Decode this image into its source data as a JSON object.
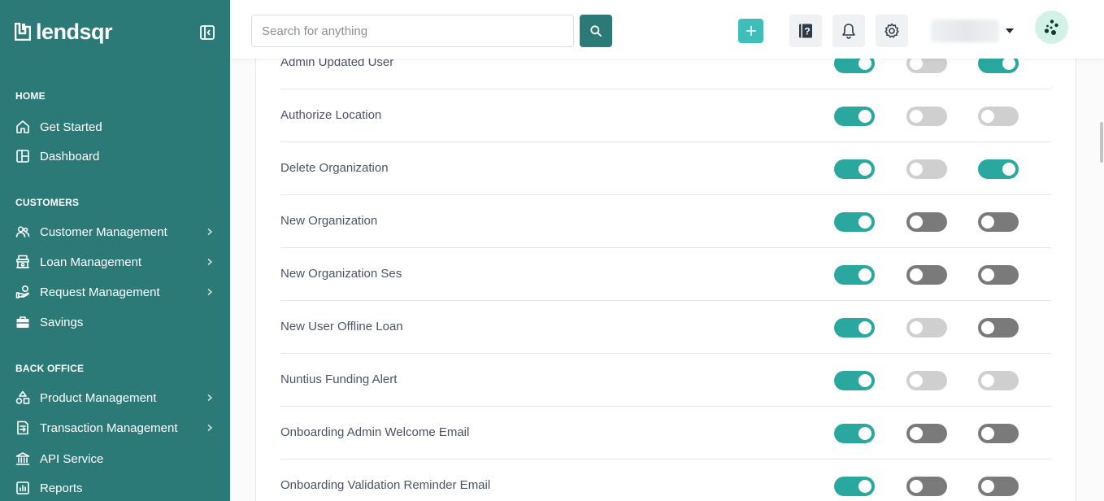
{
  "brand": {
    "name": "lendsqr"
  },
  "sidebar": {
    "sections": [
      {
        "title": "HOME",
        "items": [
          {
            "label": "Get Started",
            "icon": "home-icon",
            "chevron": false
          },
          {
            "label": "Dashboard",
            "icon": "dashboard-icon",
            "chevron": false
          }
        ]
      },
      {
        "title": "CUSTOMERS",
        "items": [
          {
            "label": "Customer Management",
            "icon": "users-icon",
            "chevron": true
          },
          {
            "label": "Loan Management",
            "icon": "loan-icon",
            "chevron": true
          },
          {
            "label": "Request Management",
            "icon": "request-icon",
            "chevron": true
          },
          {
            "label": "Savings",
            "icon": "savings-icon",
            "chevron": false
          }
        ]
      },
      {
        "title": "BACK OFFICE",
        "items": [
          {
            "label": "Product Management",
            "icon": "product-icon",
            "chevron": true
          },
          {
            "label": "Transaction Management",
            "icon": "transaction-icon",
            "chevron": true
          },
          {
            "label": "API Service",
            "icon": "bank-icon",
            "chevron": false
          },
          {
            "label": "Reports",
            "icon": "reports-icon",
            "chevron": false
          }
        ]
      }
    ]
  },
  "topbar": {
    "search": {
      "placeholder": "Search for anything",
      "value": ""
    },
    "user": {
      "name": ""
    }
  },
  "notifications": {
    "rows": [
      {
        "label": "Admin Updated User",
        "toggles": [
          "on",
          "off-light",
          "on"
        ]
      },
      {
        "label": "Authorize Location",
        "toggles": [
          "on",
          "off-light",
          "off-light"
        ]
      },
      {
        "label": "Delete Organization",
        "toggles": [
          "on",
          "off-light",
          "on"
        ]
      },
      {
        "label": "New Organization",
        "toggles": [
          "on",
          "off-dark",
          "off-dark"
        ]
      },
      {
        "label": "New Organization Ses",
        "toggles": [
          "on",
          "off-dark",
          "off-dark"
        ]
      },
      {
        "label": "New User Offline Loan",
        "toggles": [
          "on",
          "off-light",
          "off-dark"
        ]
      },
      {
        "label": "Nuntius Funding Alert",
        "toggles": [
          "on",
          "off-light",
          "off-light"
        ]
      },
      {
        "label": "Onboarding Admin Welcome Email",
        "toggles": [
          "on",
          "off-dark",
          "off-dark"
        ]
      },
      {
        "label": "Onboarding Validation Reminder Email",
        "toggles": [
          "on",
          "off-dark",
          "off-dark"
        ]
      }
    ]
  },
  "colors": {
    "sidebar": "#2b7a78",
    "toggle_on": "#2aa89f",
    "toggle_off_light": "#cfcfcf",
    "toggle_off_dark": "#7a7a7a",
    "add_button": "#3fbdb8"
  }
}
